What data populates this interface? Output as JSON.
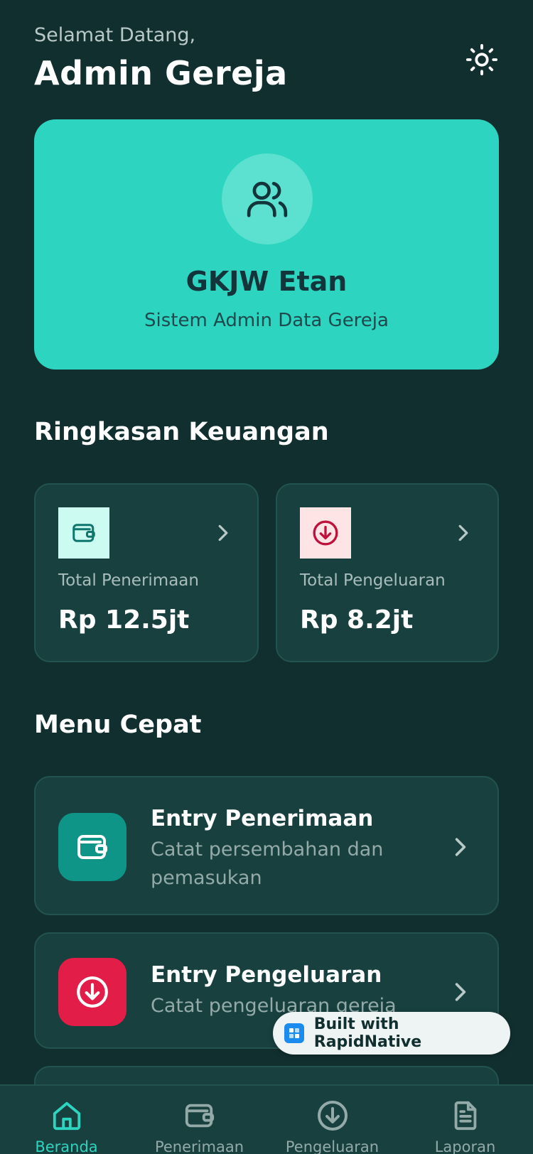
{
  "header": {
    "greeting": "Selamat Datang,",
    "title": "Admin Gereja",
    "theme_icon": "sun-icon"
  },
  "hero": {
    "icon": "users-icon",
    "name": "GKJW Etan",
    "subtitle": "Sistem Admin Data Gereja"
  },
  "summary": {
    "title": "Ringkasan Keuangan",
    "cards": [
      {
        "label": "Total Penerimaan",
        "value": "Rp 12.5jt",
        "icon": "wallet-icon",
        "icon_bg": "#ccfbf1",
        "icon_color": "#0f766e"
      },
      {
        "label": "Total Pengeluaran",
        "value": "Rp 8.2jt",
        "icon": "arrow-down-circle-icon",
        "icon_bg": "#ffe4e6",
        "icon_color": "#be123c"
      }
    ]
  },
  "quick_menu": {
    "title": "Menu Cepat",
    "items": [
      {
        "title": "Entry Penerimaan",
        "description": "Catat persembahan dan pemasukan",
        "icon": "wallet-icon",
        "icon_bg": "#0f9488"
      },
      {
        "title": "Entry Pengeluaran",
        "description": "Catat pengeluaran gereja",
        "icon": "arrow-down-circle-icon",
        "icon_bg": "#e11d48"
      }
    ]
  },
  "badge": {
    "text": "Built with RapidNative"
  },
  "bottom_nav": {
    "items": [
      {
        "label": "Beranda",
        "icon": "home-icon",
        "active": true
      },
      {
        "label": "Penerimaan",
        "icon": "wallet-icon",
        "active": false
      },
      {
        "label": "Pengeluaran",
        "icon": "arrow-down-circle-icon",
        "active": false
      },
      {
        "label": "Laporan",
        "icon": "document-icon",
        "active": false
      }
    ]
  },
  "colors": {
    "background": "#122f30",
    "card": "#17403f",
    "accent": "#2dd4bf"
  }
}
